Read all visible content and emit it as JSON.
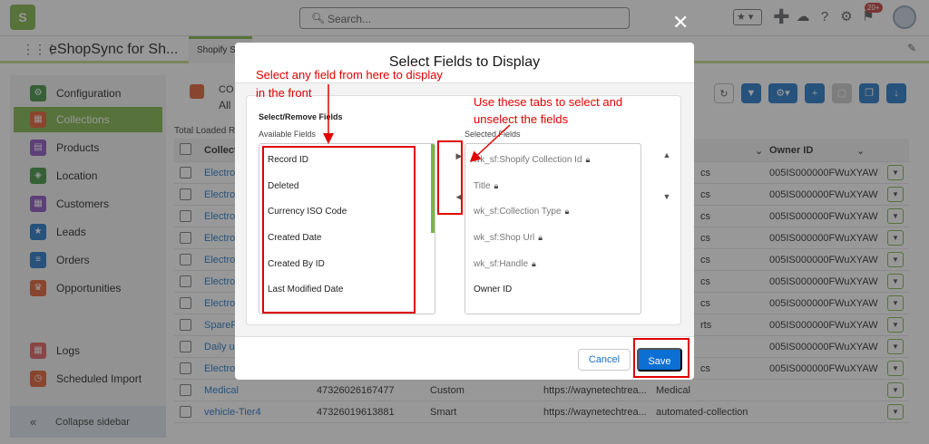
{
  "topbar": {
    "logo": "S",
    "search_placeholder": "Search...",
    "notification_count": "20+"
  },
  "appbar": {
    "app_name": "eShopSync for Sh...",
    "tab_label": "Shopify S"
  },
  "sidebar": {
    "items": [
      {
        "label": "Configuration",
        "color": "#3a8f3a"
      },
      {
        "label": "Collections",
        "color": "#e05a2b"
      },
      {
        "label": "Products",
        "color": "#8a4fbf"
      },
      {
        "label": "Location",
        "color": "#3a8f3a"
      },
      {
        "label": "Customers",
        "color": "#8a4fbf"
      },
      {
        "label": "Leads",
        "color": "#1b72c6"
      },
      {
        "label": "Orders",
        "color": "#1b72c6"
      },
      {
        "label": "Opportunities",
        "color": "#e05a2b"
      },
      {
        "label": "Logs",
        "color": "#e05a5a"
      },
      {
        "label": "Scheduled Import",
        "color": "#e05a2b"
      }
    ],
    "collapse_label": "Collapse sidebar"
  },
  "main": {
    "object_label_1": "CO",
    "object_label_2": "All",
    "total_label": "Total Loaded R",
    "headers": {
      "name": "Collect",
      "owner": "Owner ID"
    },
    "rows": [
      {
        "name": "Electron",
        "c5": "cs",
        "owner": "005IS000000FWuXYAW"
      },
      {
        "name": "Electron",
        "c5": "cs",
        "owner": "005IS000000FWuXYAW"
      },
      {
        "name": "Electron",
        "c5": "cs",
        "owner": "005IS000000FWuXYAW"
      },
      {
        "name": "Electron",
        "c5": "cs",
        "owner": "005IS000000FWuXYAW"
      },
      {
        "name": "Electron",
        "c5": "cs",
        "owner": "005IS000000FWuXYAW"
      },
      {
        "name": "Electron",
        "c5": "cs",
        "owner": "005IS000000FWuXYAW"
      },
      {
        "name": "Electron",
        "c5": "cs",
        "owner": "005IS000000FWuXYAW"
      },
      {
        "name": "SpareP",
        "c5": "rts",
        "owner": "005IS000000FWuXYAW"
      },
      {
        "name": "Daily us",
        "c5": "",
        "owner": "005IS000000FWuXYAW"
      },
      {
        "name": "Electron",
        "c5": "cs",
        "owner": "005IS000000FWuXYAW"
      },
      {
        "name": "Medical",
        "id": "47326026167477",
        "type": "Custom",
        "url": "https://waynetechtrea...",
        "c5": "Medical",
        "owner": ""
      },
      {
        "name": "vehicle-Tier4",
        "id": "47326019613881",
        "type": "Smart",
        "url": "https://waynetechtrea...",
        "c5": "automated-collection",
        "owner": ""
      }
    ]
  },
  "modal": {
    "title": "Select Fields to Display",
    "section_title": "Select/Remove Fields",
    "available_label": "Available Fields",
    "selected_label": "Selected Fields",
    "available": [
      "Record ID",
      "Deleted",
      "Currency ISO Code",
      "Created Date",
      "Created By ID",
      "Last Modified Date"
    ],
    "selected": [
      {
        "label": "wk_sf:Shopify Collection Id",
        "locked": true
      },
      {
        "label": "Title",
        "locked": true
      },
      {
        "label": "wk_sf:Collection Type",
        "locked": true
      },
      {
        "label": "wk_sf:Shop Url",
        "locked": true
      },
      {
        "label": "wk_sf:Handle",
        "locked": true
      },
      {
        "label": "Owner ID",
        "locked": false
      }
    ],
    "cancel_label": "Cancel",
    "save_label": "Save"
  },
  "annotations": {
    "left_note_line1": "Select any field from here to display",
    "left_note_line2": "in the front",
    "right_note_line1": "Use these tabs to select and",
    "right_note_line2": "unselect the fields",
    "color": "#e00000"
  }
}
